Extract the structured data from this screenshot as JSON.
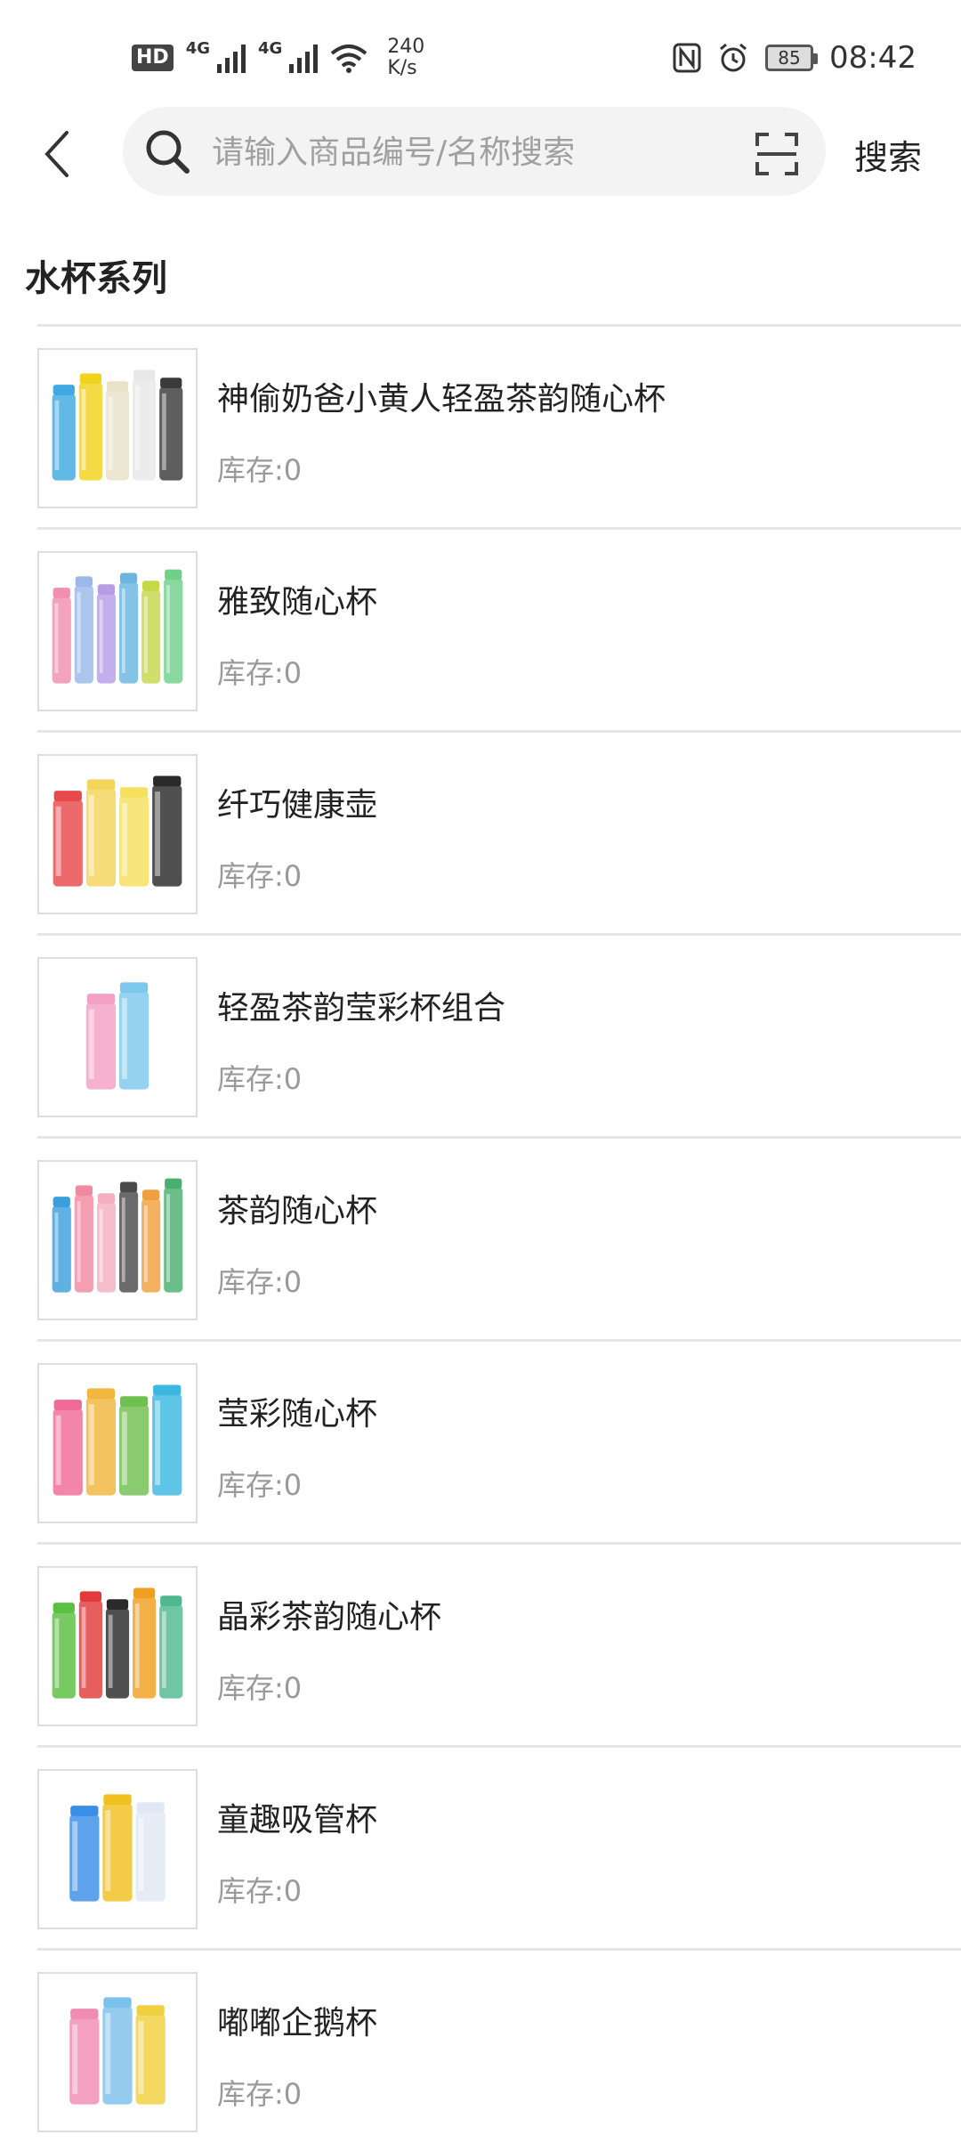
{
  "status_bar": {
    "hd": "HD",
    "net1": "4G",
    "net2": "4G",
    "speed_value": "240",
    "speed_unit": "K/s",
    "battery": "85",
    "time": "08:42"
  },
  "header": {
    "search_placeholder": "请输入商品编号/名称搜索",
    "search_button": "搜索"
  },
  "section_title": "水杯系列",
  "products": [
    {
      "name": "神偷奶爸小黄人轻盈茶韵随心杯",
      "stock": "库存:0",
      "colors": [
        "#3fa9e0",
        "#f2d31c",
        "#e8e2c8",
        "#e8e8e8",
        "#3b3b3b"
      ]
    },
    {
      "name": "雅致随心杯",
      "stock": "库存:0",
      "colors": [
        "#f08fb0",
        "#9ab8e8",
        "#b79ce6",
        "#6ab6e0",
        "#c6d84a",
        "#6fd08a"
      ]
    },
    {
      "name": "纤巧健康壶",
      "stock": "库存:0",
      "colors": [
        "#e8494a",
        "#f4d45a",
        "#f6e060",
        "#2a2a2a"
      ]
    },
    {
      "name": "轻盈茶韵莹彩杯组合",
      "stock": "库存:0",
      "colors": [
        "#f4a0c4",
        "#7cc8ec"
      ]
    },
    {
      "name": "茶韵随心杯",
      "stock": "库存:0",
      "colors": [
        "#3aa0dc",
        "#f08aa0",
        "#f4b0bf",
        "#4a4a4a",
        "#f0a040",
        "#4ab070"
      ]
    },
    {
      "name": "莹彩随心杯",
      "stock": "库存:0",
      "colors": [
        "#f06a98",
        "#f2b63e",
        "#70c050",
        "#3ab8e0"
      ]
    },
    {
      "name": "晶彩茶韵随心杯",
      "stock": "库存:0",
      "colors": [
        "#5ac040",
        "#e23a3a",
        "#2a2a2a",
        "#f0a020",
        "#50b890"
      ]
    },
    {
      "name": "童趣吸管杯",
      "stock": "库存:0",
      "colors": [
        "#3a8ee8",
        "#f0c020",
        "#dfe8f4"
      ]
    },
    {
      "name": "嘟嘟企鹅杯",
      "stock": "库存:0",
      "colors": [
        "#f08cb0",
        "#7cc0ec",
        "#f0d040"
      ]
    }
  ]
}
